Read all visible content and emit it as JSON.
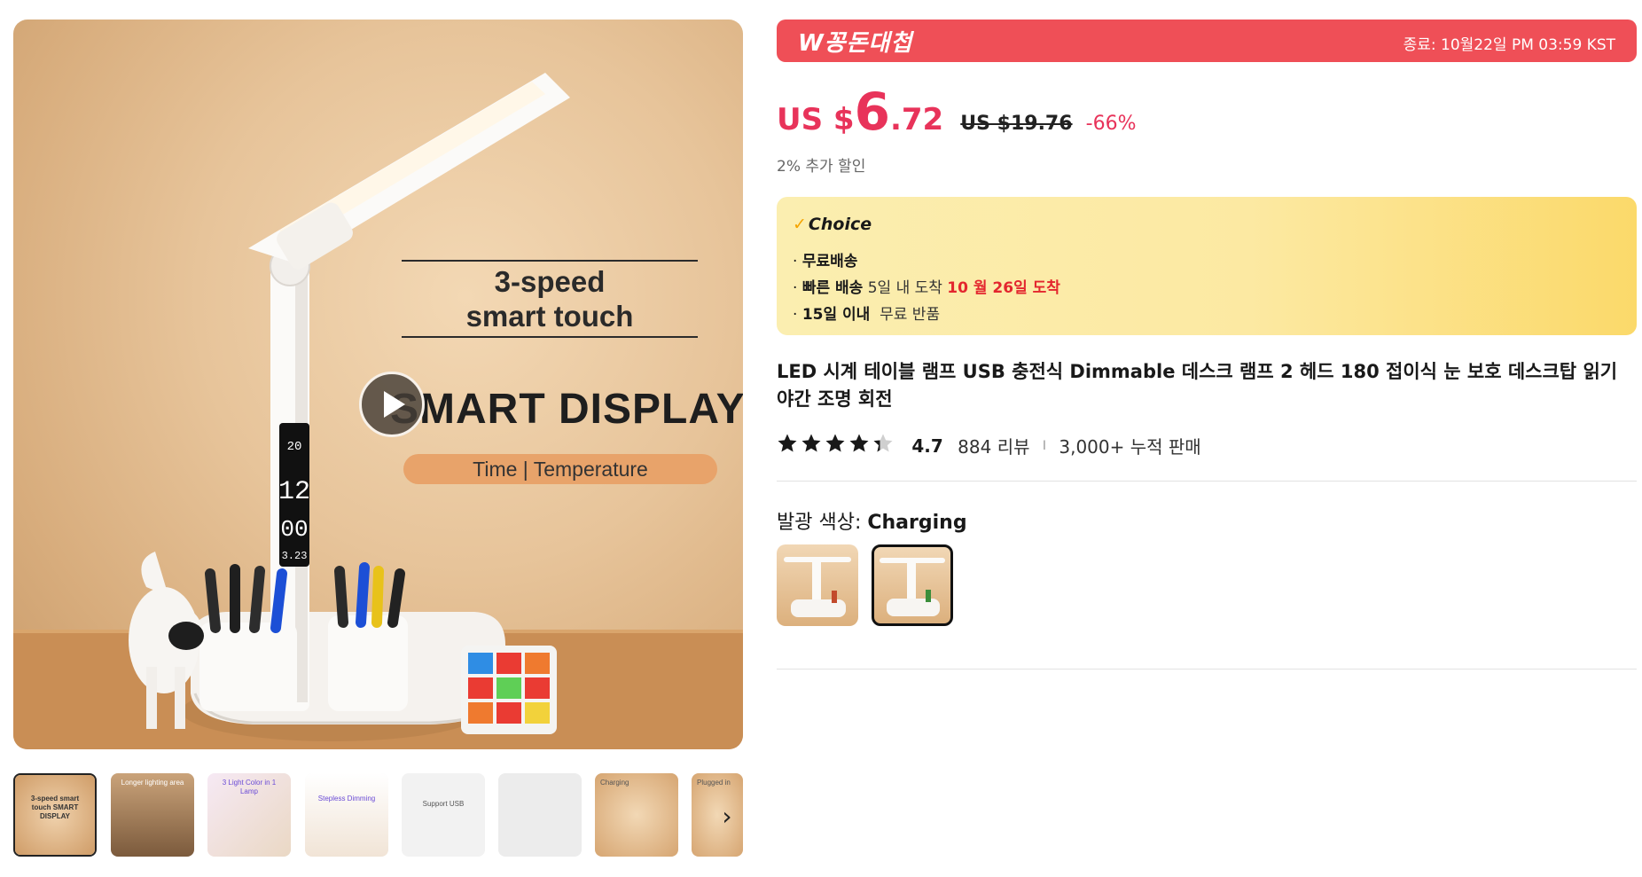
{
  "gallery": {
    "hero": {
      "speed_text": "3-speed\nsmart touch",
      "display_text": "SMART DISPLAY",
      "pill_text": "Time | Temperature"
    },
    "thumbnails": [
      {
        "label": "3-speed smart touch SMART DISPLAY"
      },
      {
        "label": "Longer lighting area"
      },
      {
        "label": "3 Light Color in 1 Lamp"
      },
      {
        "label": "Stepless Dimming"
      },
      {
        "label": "Support USB"
      },
      {
        "label": ""
      },
      {
        "label": "Charging"
      },
      {
        "label": "Plugged in"
      }
    ],
    "next_icon": "chevron-right-icon"
  },
  "banner": {
    "logo": "W꽁돈대첩",
    "end_text": "종료: 10월22일 PM 03:59 KST",
    "color": "#ef4f57"
  },
  "price": {
    "currency": "US $",
    "integer": "6",
    "decimal": ".72",
    "original": "US $19.76",
    "discount": "-66%",
    "extra": "2% 추가 할인",
    "accent_color": "#e8335a"
  },
  "choice": {
    "title": "Choice",
    "free_shipping": "무료배송",
    "fast_label": "빠른 배송",
    "fast_days": "5일 내 도착",
    "fast_date": "10 월 26일 도착",
    "return_label": "15일 이내",
    "return_text": "무료 반품"
  },
  "product": {
    "title": "LED 시계 테이블 램프 USB 충전식 Dimmable 데스크 램프 2 헤드 180 접이식 눈 보호 데스크탑 읽기 야간 조명 회전",
    "rating": "4.7",
    "stars": 4.7,
    "reviews": "884 리뷰",
    "separator": "I",
    "sold": "3,000+ 누적 판매"
  },
  "variant": {
    "label": "발광 색상: ",
    "value": "Charging",
    "options": [
      "Plugged in",
      "Charging"
    ],
    "selected_index": 1
  }
}
